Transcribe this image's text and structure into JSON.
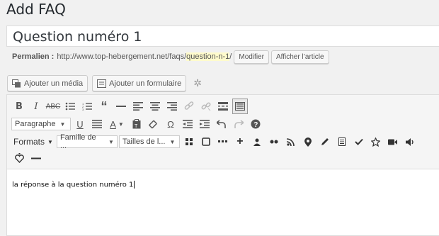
{
  "page": {
    "title": "Add FAQ"
  },
  "post": {
    "title": "Question numéro 1",
    "permalink_label": "Permalien :",
    "permalink_base": "http://www.top-hebergement.net/faqs/",
    "permalink_slug": "question-n-1",
    "permalink_trailing": "/",
    "edit_label": "Modifier",
    "view_label": "Afficher l’article"
  },
  "media_bar": {
    "add_media": "Ajouter un média",
    "add_form": "Ajouter un formulaire"
  },
  "toolbar": {
    "format_select": "Paragraphe",
    "formats_menu": "Formats",
    "font_family": "Famille de ...",
    "font_size": "Tailles de l...",
    "row1_icons": [
      "bold-icon",
      "italic-icon",
      "strikethrough-icon",
      "bullet-list-icon",
      "numbered-list-icon",
      "blockquote-icon",
      "horizontal-line-icon",
      "align-left-icon",
      "align-center-icon",
      "align-right-icon",
      "link-icon",
      "unlink-icon",
      "read-more-icon",
      "toolbar-toggle-icon"
    ],
    "bold_glyph": "B",
    "italic_glyph": "I",
    "strike_glyph": "ABC",
    "underline_glyph": "U",
    "text_color_glyph": "A",
    "omega_glyph": "Ω",
    "help_glyph": "?"
  },
  "editor": {
    "content": "la réponse à la question numéro 1"
  }
}
